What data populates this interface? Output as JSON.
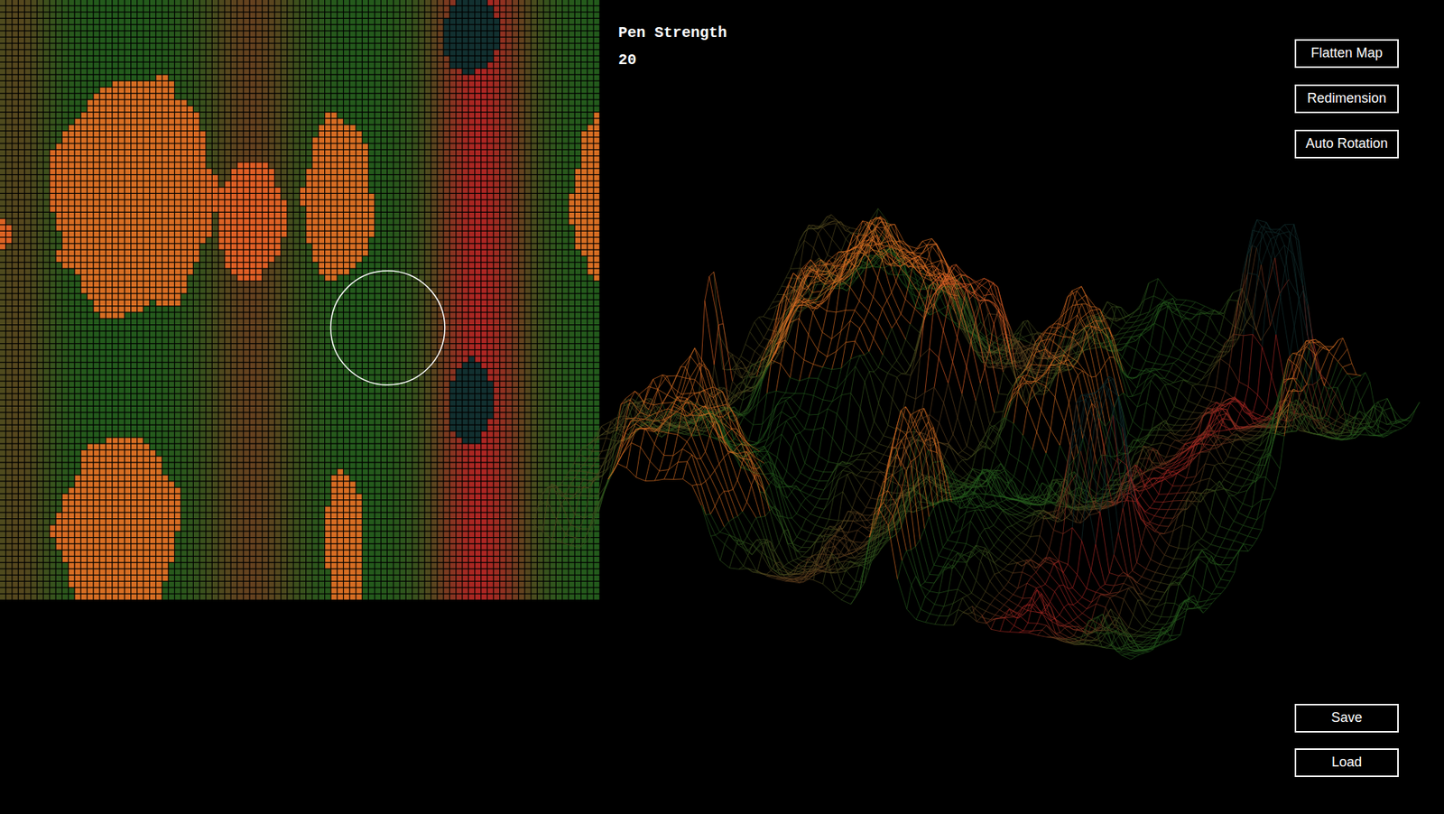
{
  "pen": {
    "label": "Pen Strength",
    "value": "20"
  },
  "view_buttons": [
    {
      "label": "Flatten Map"
    },
    {
      "label": "Redimension"
    },
    {
      "label": "Auto Rotation"
    }
  ],
  "file_buttons": [
    {
      "label": "Save"
    },
    {
      "label": "Load"
    }
  ],
  "brush": {
    "x": 0.646,
    "y": 0.546,
    "radius": 0.095
  }
}
